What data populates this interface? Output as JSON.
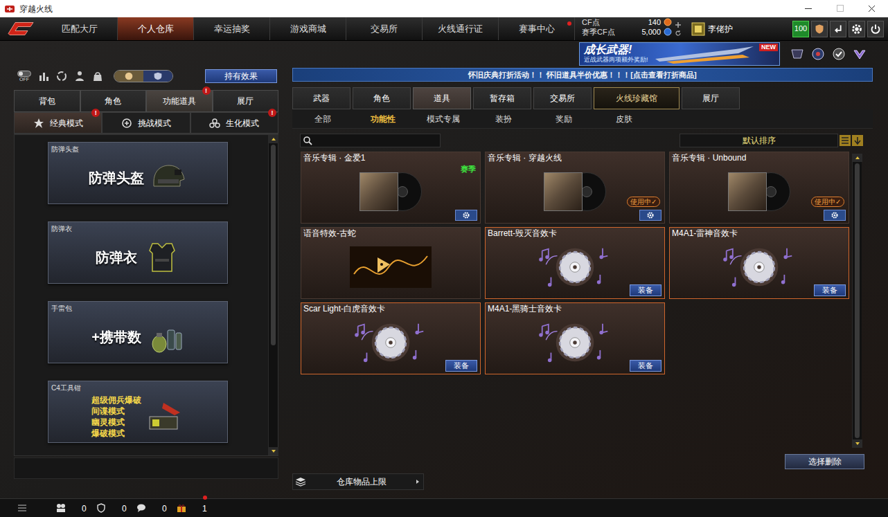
{
  "window": {
    "title": "穿越火线"
  },
  "nav": {
    "tabs": [
      {
        "label": "匹配大厅",
        "selected": false,
        "alert": false
      },
      {
        "label": "个人仓库",
        "selected": true,
        "alert": false
      },
      {
        "label": "幸运抽奖",
        "selected": false,
        "alert": false
      },
      {
        "label": "游戏商城",
        "selected": false,
        "alert": false
      },
      {
        "label": "交易所",
        "selected": false,
        "alert": false
      },
      {
        "label": "火线通行证",
        "selected": false,
        "alert": false
      },
      {
        "label": "赛事中心",
        "selected": false,
        "alert": true
      }
    ],
    "currency": [
      {
        "label": "CF点",
        "value": "140"
      },
      {
        "label": "赛季CF点",
        "value": "5,000"
      }
    ],
    "player": {
      "name": "李佬护"
    },
    "level": "100"
  },
  "banner": {
    "title": "成长武器!",
    "subtitle": "近战武器两项额外奖励!",
    "badge": "NEW"
  },
  "left": {
    "toggle": "OFF",
    "effect_button": "持有效果",
    "alert_mark": "!",
    "tabs": [
      {
        "label": "背包",
        "selected": false,
        "alert": false
      },
      {
        "label": "角色",
        "selected": false,
        "alert": false
      },
      {
        "label": "功能道具",
        "selected": true,
        "alert": true
      },
      {
        "label": "展厅",
        "selected": false,
        "alert": false
      }
    ],
    "modes": [
      {
        "label": "经典模式",
        "selected": true,
        "alert": true
      },
      {
        "label": "挑战模式",
        "selected": false,
        "alert": false
      },
      {
        "label": "生化模式",
        "selected": false,
        "alert": true
      }
    ],
    "items": [
      {
        "label": "防弹头盔",
        "lines": [
          "防弹头盔"
        ]
      },
      {
        "label": "防弹衣",
        "lines": [
          "防弹衣"
        ]
      },
      {
        "label": "手雷包",
        "lines": [
          "+携带数"
        ]
      },
      {
        "label": "C4工具钳",
        "lines": [
          "超级佣兵爆破",
          "间谍模式",
          "幽灵模式",
          "爆破模式"
        ]
      }
    ]
  },
  "right": {
    "notice": "怀旧庆典打折活动！！ 怀旧道具半价优惠！！！[点击查看打折商品]",
    "tabs": [
      {
        "label": "武器",
        "selected": false,
        "kind": "normal"
      },
      {
        "label": "角色",
        "selected": false,
        "kind": "normal"
      },
      {
        "label": "道具",
        "selected": true,
        "kind": "normal"
      },
      {
        "label": "暂存箱",
        "selected": false,
        "kind": "normal"
      },
      {
        "label": "交易所",
        "selected": false,
        "kind": "normal"
      },
      {
        "label": "火线珍藏馆",
        "selected": false,
        "kind": "special"
      },
      {
        "label": "展厅",
        "selected": false,
        "kind": "normal"
      }
    ],
    "subtabs": [
      {
        "label": "全部",
        "selected": false
      },
      {
        "label": "功能性",
        "selected": true
      },
      {
        "label": "模式专属",
        "selected": false
      },
      {
        "label": "装扮",
        "selected": false
      },
      {
        "label": "奖励",
        "selected": false
      },
      {
        "label": "皮肤",
        "selected": false
      }
    ],
    "sort": "默认排序",
    "in_use_label": "使用中✓",
    "equip_label": "装备",
    "items": [
      {
        "kind": "album",
        "title": "音乐专辑 · 金爱1",
        "tag": "赛季",
        "in_use": false
      },
      {
        "kind": "album",
        "title": "音乐专辑 · 穿越火线",
        "in_use": true
      },
      {
        "kind": "album",
        "title": "音乐专辑 · Unbound",
        "in_use": true
      },
      {
        "kind": "voice",
        "title": "语音特效-古蛇"
      },
      {
        "kind": "card",
        "title": "Barrett-毁灭音效卡"
      },
      {
        "kind": "card",
        "title": "M4A1-雷神音效卡"
      },
      {
        "kind": "card",
        "title": "Scar Light-白虎音效卡"
      },
      {
        "kind": "card",
        "title": "M4A1-黑骑士音效卡"
      }
    ],
    "delete_button": "选择删除",
    "capacity": "仓库物品上限"
  },
  "status_bar": {
    "items": [
      {
        "count": "0",
        "alert": false
      },
      {
        "count": "0",
        "alert": false
      },
      {
        "count": "0",
        "alert": false
      },
      {
        "count": "1",
        "alert": true
      }
    ]
  }
}
